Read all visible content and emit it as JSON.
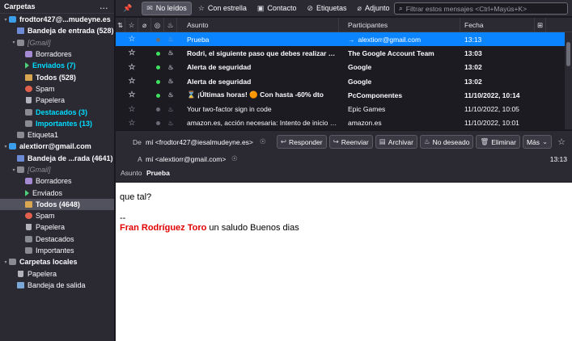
{
  "sidebar": {
    "title": "Carpetas",
    "menu": "...",
    "folders": [
      {
        "label": "frodtor427@...mudeyne.es",
        "icon": "account-icon",
        "ic": "acct",
        "indent": 0,
        "twisty": "▾",
        "cls": "bold"
      },
      {
        "label": "Bandeja de entrada (528)",
        "icon": "inbox-icon",
        "ic": "inbox",
        "indent": 1,
        "twisty": "",
        "cls": "bold"
      },
      {
        "label": "[Gmail]",
        "icon": "folder-icon",
        "ic": "fold",
        "indent": 1,
        "twisty": "▾",
        "cls": "italic"
      },
      {
        "label": "Borradores",
        "icon": "drafts-icon",
        "ic": "draft",
        "indent": 2,
        "twisty": "",
        "cls": ""
      },
      {
        "label": "Enviados (7)",
        "icon": "sent-icon",
        "ic": "sent",
        "indent": 2,
        "twisty": "",
        "cls": "blue"
      },
      {
        "label": "Todos (528)",
        "icon": "all-mail-icon",
        "ic": "all",
        "indent": 2,
        "twisty": "",
        "cls": "bold"
      },
      {
        "label": "Spam",
        "icon": "spam-icon",
        "ic": "spam",
        "indent": 2,
        "twisty": "",
        "cls": ""
      },
      {
        "label": "Papelera",
        "icon": "trash-icon",
        "ic": "trash",
        "indent": 2,
        "twisty": "",
        "cls": ""
      },
      {
        "label": "Destacados (3)",
        "icon": "starred-folder-icon",
        "ic": "fold",
        "indent": 2,
        "twisty": "",
        "cls": "blue"
      },
      {
        "label": "Importantes (13)",
        "icon": "important-folder-icon",
        "ic": "fold",
        "indent": 2,
        "twisty": "",
        "cls": "blue"
      },
      {
        "label": "Etiqueta1",
        "icon": "folder-icon",
        "ic": "fold",
        "indent": 1,
        "twisty": "",
        "cls": ""
      },
      {
        "label": "alextiorr@gmail.com",
        "icon": "account-icon",
        "ic": "acct",
        "indent": 0,
        "twisty": "▾",
        "cls": "bold"
      },
      {
        "label": "Bandeja de ...rada (4641)",
        "icon": "inbox-icon",
        "ic": "inbox",
        "indent": 1,
        "twisty": "",
        "cls": "bold"
      },
      {
        "label": "[Gmail]",
        "icon": "folder-icon",
        "ic": "fold",
        "indent": 1,
        "twisty": "▾",
        "cls": "italic"
      },
      {
        "label": "Borradores",
        "icon": "drafts-icon",
        "ic": "draft",
        "indent": 2,
        "twisty": "",
        "cls": ""
      },
      {
        "label": "Enviados",
        "icon": "sent-icon",
        "ic": "sent",
        "indent": 2,
        "twisty": "",
        "cls": ""
      },
      {
        "label": "Todos (4648)",
        "icon": "all-mail-icon",
        "ic": "all",
        "indent": 2,
        "twisty": "",
        "cls": "bold sel"
      },
      {
        "label": "Spam",
        "icon": "spam-icon",
        "ic": "spam",
        "indent": 2,
        "twisty": "",
        "cls": ""
      },
      {
        "label": "Papelera",
        "icon": "trash-icon",
        "ic": "trash",
        "indent": 2,
        "twisty": "",
        "cls": ""
      },
      {
        "label": "Destacados",
        "icon": "starred-folder-icon",
        "ic": "fold",
        "indent": 2,
        "twisty": "",
        "cls": ""
      },
      {
        "label": "Importantes",
        "icon": "important-folder-icon",
        "ic": "fold",
        "indent": 2,
        "twisty": "",
        "cls": ""
      },
      {
        "label": "Carpetas locales",
        "icon": "local-folders-icon",
        "ic": "fold",
        "indent": 0,
        "twisty": "▾",
        "cls": "bold"
      },
      {
        "label": "Papelera",
        "icon": "trash-icon",
        "ic": "trash",
        "indent": 1,
        "twisty": "",
        "cls": ""
      },
      {
        "label": "Bandeja de salida",
        "icon": "outbox-icon",
        "ic": "outbox",
        "indent": 1,
        "twisty": "",
        "cls": ""
      }
    ]
  },
  "toolbar": {
    "unread": "No leídos",
    "starred": "Con estrella",
    "contact": "Contacto",
    "tags": "Etiquetas",
    "attachment": "Adjunto",
    "filter_placeholder": "Filtrar estos mensajes <Ctrl+Mayús+K>"
  },
  "list": {
    "headers": {
      "subject": "Asunto",
      "participants": "Participantes",
      "date": "Fecha"
    },
    "rows": [
      {
        "subject": "Prueba",
        "participant": "alextiorr@gmail.com",
        "date": "13:13",
        "bold": false,
        "selected": true,
        "green": false,
        "arrow": true
      },
      {
        "subject": "Rodri, el siguiente paso que debes realizar en ...",
        "participant": "The Google Account Team",
        "date": "13:03",
        "bold": true,
        "selected": false,
        "green": true,
        "arrow": false
      },
      {
        "subject": "Alerta de seguridad",
        "participant": "Google",
        "date": "13:02",
        "bold": true,
        "selected": false,
        "green": true,
        "arrow": false
      },
      {
        "subject": "Alerta de seguridad",
        "participant": "Google",
        "date": "13:02",
        "bold": true,
        "selected": false,
        "green": true,
        "arrow": false
      },
      {
        "subject": "⌛ ¡Últimas horas! 🟠 Con hasta -60% dto",
        "participant": "PcComponentes",
        "date": "11/10/2022, 10:14",
        "bold": true,
        "selected": false,
        "green": true,
        "arrow": false
      },
      {
        "subject": "Your two-factor sign in code",
        "participant": "Epic Games",
        "date": "11/10/2022, 10:05",
        "bold": false,
        "selected": false,
        "green": false,
        "arrow": false
      },
      {
        "subject": "amazon.es, acción necesaria: Intento de inicio de...",
        "participant": "amazon.es",
        "date": "11/10/2022, 10:01",
        "bold": false,
        "selected": false,
        "green": false,
        "arrow": false
      }
    ]
  },
  "header": {
    "from_label": "De",
    "from_value": "mí <frodtor427@iesalmudeyne.es>",
    "to_label": "A",
    "to_value": "mí <alextiorr@gmail.com>",
    "subject_label": "Asunto",
    "subject_value": "Prueba",
    "time": "13:13",
    "buttons": {
      "reply": "Responder",
      "forward": "Reenviar",
      "archive": "Archivar",
      "junk": "No deseado",
      "delete": "Eliminar",
      "more": "Más"
    }
  },
  "body": {
    "line1": "que tal?",
    "sig_sep": "--",
    "sig_name": "Fran Rodríguez Toro",
    "sig_text": " un saludo Buenos dias"
  }
}
